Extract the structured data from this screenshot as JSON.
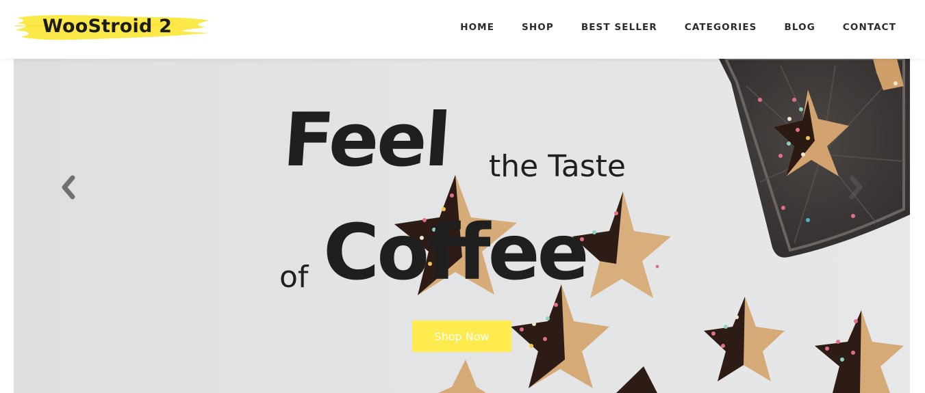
{
  "header": {
    "logo_text": "WooStroid 2",
    "logo_brush_color": "#fbe94a",
    "nav": [
      {
        "label": "HOME"
      },
      {
        "label": "SHOP"
      },
      {
        "label": "BEST SELLER"
      },
      {
        "label": "CATEGORIES"
      },
      {
        "label": "BLOG"
      },
      {
        "label": "CONTACT"
      }
    ]
  },
  "hero": {
    "headline": {
      "word_feel": "Feel",
      "phrase_taste": "the Taste",
      "word_of": "of",
      "word_coffee": "Coffee"
    },
    "cta_label": "Shop Now",
    "cta_color": "#ffeb4d",
    "prev_icon": "chevron-left-icon",
    "next_icon": "chevron-right-icon",
    "background_image": "star-cookies-with-chocolate-and-sprinkles-on-baking-tray"
  }
}
